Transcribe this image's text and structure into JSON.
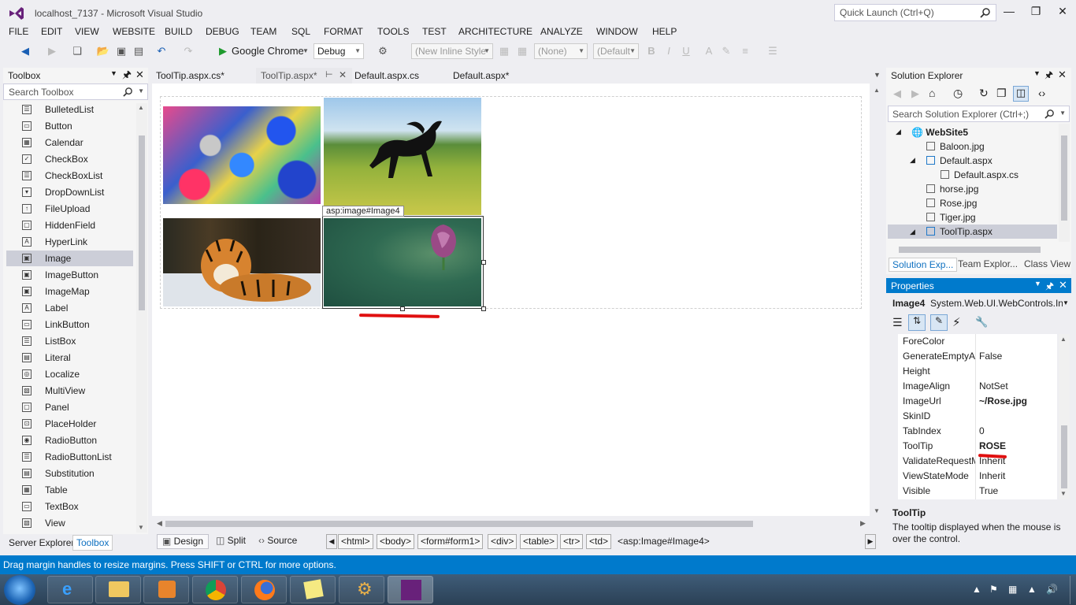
{
  "window": {
    "title": "localhost_7137 - Microsoft Visual Studio",
    "quick_launch": "Quick Launch (Ctrl+Q)"
  },
  "menu": [
    "FILE",
    "EDIT",
    "VIEW",
    "WEBSITE",
    "BUILD",
    "DEBUG",
    "TEAM",
    "SQL",
    "FORMAT",
    "TOOLS",
    "TEST",
    "ARCHITECTURE",
    "ANALYZE",
    "WINDOW",
    "HELP"
  ],
  "toolbar": {
    "browser": "Google Chrome",
    "config": "Debug",
    "style_combo": "(New Inline Style",
    "target_combo": "(None)",
    "font_combo": "(Default",
    "bold": "B",
    "italic": "I",
    "underline": "U"
  },
  "toolbox": {
    "title": "Toolbox",
    "search_placeholder": "Search Toolbox",
    "items": [
      {
        "label": "BulletedList",
        "icon": "list-icon"
      },
      {
        "label": "Button",
        "icon": "button-icon"
      },
      {
        "label": "Calendar",
        "icon": "calendar-icon"
      },
      {
        "label": "CheckBox",
        "icon": "checkbox-icon"
      },
      {
        "label": "CheckBoxList",
        "icon": "list-icon"
      },
      {
        "label": "DropDownList",
        "icon": "dropdown-icon"
      },
      {
        "label": "FileUpload",
        "icon": "upload-icon"
      },
      {
        "label": "HiddenField",
        "icon": "field-icon"
      },
      {
        "label": "HyperLink",
        "icon": "link-icon"
      },
      {
        "label": "Image",
        "icon": "image-icon"
      },
      {
        "label": "ImageButton",
        "icon": "image-icon"
      },
      {
        "label": "ImageMap",
        "icon": "image-icon"
      },
      {
        "label": "Label",
        "icon": "label-icon"
      },
      {
        "label": "LinkButton",
        "icon": "button-icon"
      },
      {
        "label": "ListBox",
        "icon": "list-icon"
      },
      {
        "label": "Literal",
        "icon": "literal-icon"
      },
      {
        "label": "Localize",
        "icon": "globe-icon"
      },
      {
        "label": "MultiView",
        "icon": "view-icon"
      },
      {
        "label": "Panel",
        "icon": "panel-icon"
      },
      {
        "label": "PlaceHolder",
        "icon": "placeholder-icon"
      },
      {
        "label": "RadioButton",
        "icon": "radio-icon"
      },
      {
        "label": "RadioButtonList",
        "icon": "list-icon"
      },
      {
        "label": "Substitution",
        "icon": "substitution-icon"
      },
      {
        "label": "Table",
        "icon": "table-icon"
      },
      {
        "label": "TextBox",
        "icon": "textbox-icon"
      },
      {
        "label": "View",
        "icon": "view-icon"
      }
    ],
    "selected": "Image",
    "bottom_tabs": [
      "Server Explorer",
      "Toolbox"
    ]
  },
  "editor": {
    "tabs": [
      "ToolTip.aspx.cs*",
      "ToolTip.aspx*",
      "Default.aspx.cs",
      "Default.aspx*"
    ],
    "selection_tag": "asp:image#Image4",
    "views": [
      "Design",
      "Split",
      "Source"
    ],
    "breadcrumbs": [
      "<html>",
      "<body>",
      "<form#form1>",
      "<div>",
      "<table>",
      "<tr>",
      "<td>"
    ],
    "current_element": "<asp:Image#Image4>"
  },
  "solution_explorer": {
    "title": "Solution Explorer",
    "search_placeholder": "Search Solution Explorer (Ctrl+;)",
    "items": [
      "WebSite5",
      "Baloon.jpg",
      "Default.aspx",
      "Default.aspx.cs",
      "horse.jpg",
      "Rose.jpg",
      "Tiger.jpg",
      "ToolTip.aspx"
    ],
    "tabs": [
      "Solution Exp...",
      "Team Explor...",
      "Class View"
    ]
  },
  "properties": {
    "title": "Properties",
    "object_name": "Image4",
    "object_type": "System.Web.UI.WebControls.In",
    "rows": [
      {
        "name": "ForeColor",
        "value": ""
      },
      {
        "name": "GenerateEmptyAl",
        "value": "False"
      },
      {
        "name": "Height",
        "value": ""
      },
      {
        "name": "ImageAlign",
        "value": "NotSet"
      },
      {
        "name": "ImageUrl",
        "value": "~/Rose.jpg"
      },
      {
        "name": "SkinID",
        "value": ""
      },
      {
        "name": "TabIndex",
        "value": "0"
      },
      {
        "name": "ToolTip",
        "value": "ROSE"
      },
      {
        "name": "ValidateRequestM",
        "value": "Inherit"
      },
      {
        "name": "ViewStateMode",
        "value": "Inherit"
      },
      {
        "name": "Visible",
        "value": "True"
      }
    ],
    "desc_title": "ToolTip",
    "desc_text": "The tooltip displayed when the mouse is over the control."
  },
  "status": "Drag margin handles to resize margins. Press SHIFT or CTRL for more options.",
  "colors": {
    "accent": "#007acc",
    "selection": "#ccced8",
    "annotation": "#e01010"
  }
}
